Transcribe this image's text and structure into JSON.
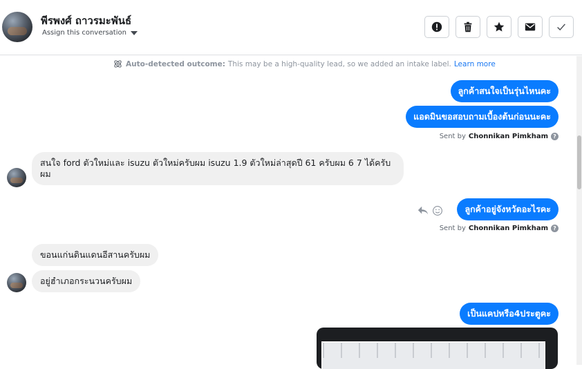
{
  "header": {
    "contact_name": "พีรพงศ์ ถาวรมะพันธ์",
    "assign_label": "Assign this conversation",
    "actions": [
      {
        "name": "mark-spam-button",
        "icon": "alert-icon"
      },
      {
        "name": "delete-button",
        "icon": "trash-icon"
      },
      {
        "name": "star-button",
        "icon": "star-icon"
      },
      {
        "name": "mark-unread-button",
        "icon": "envelope-icon"
      },
      {
        "name": "mark-done-button",
        "icon": "check-icon"
      }
    ]
  },
  "notice": {
    "label": "Auto-detected outcome:",
    "text": "This may be a high-quality lead, so we added an intake label.",
    "link": "Learn more"
  },
  "messages": {
    "m1": "ลูกค้าสนใจเป็นรุ่นไหนคะ",
    "m2": "แอดมินขอสอบถามเบื้องต้นก่อนนะคะ",
    "sent1_prefix": "Sent by",
    "sent1_name": "Chonnikan Pimkham",
    "m3": "สนใจ ford ตัวใหม่และ isuzu ตัวใหม่ครับผม isuzu 1.9 ตัวใหม่ล่าสุดปี 61 ครับผม 6 7 ได้ครับผม",
    "m4": "ลูกค้าอยู่จังหวัดอะไรคะ",
    "sent2_prefix": "Sent by",
    "sent2_name": "Chonnikan Pimkham",
    "m5": "ขอนแก่นดินแดนอีสานครับผม",
    "m6": "อยู่ฮำเภอกระนวนครับผม",
    "m7": "เป็นแคปหรือ4ประตูคะ",
    "help_glyph": "?"
  },
  "colors": {
    "outgoing_bubble": "#0a7cff",
    "incoming_bubble": "#f0f0f0",
    "link": "#1877f2"
  }
}
